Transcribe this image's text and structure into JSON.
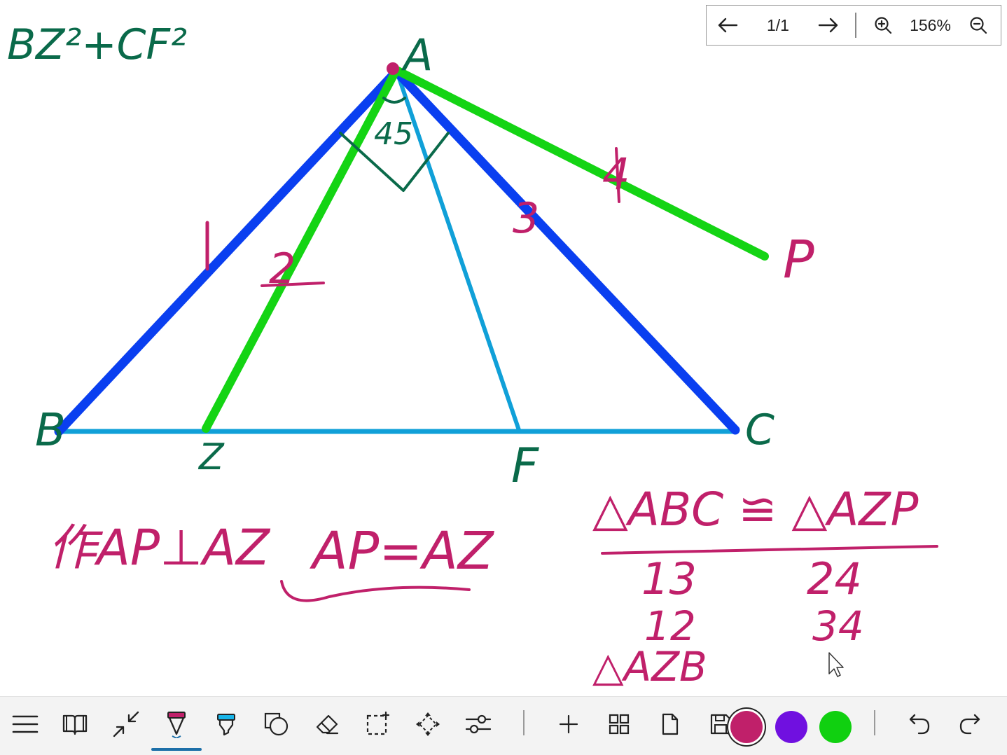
{
  "nav": {
    "page_indicator": "1/1",
    "zoom_level": "156%"
  },
  "canvas": {
    "corner_formula": "BZ²+CF²",
    "vertex_labels": [
      "A",
      "B",
      "C",
      "Z",
      "F",
      "P"
    ],
    "angle_label": "45",
    "segment_numbers": [
      "1",
      "2",
      "3",
      "4"
    ],
    "note_construct": "作AP⊥AZ",
    "note_equal": "AP=AZ",
    "note_congruence": "△ABC ≌ △AZP",
    "note_row1_left": "13",
    "note_row1_right": "24",
    "note_row2_left": "12",
    "note_row2_right": "34",
    "note_row3_left": "△AZB"
  },
  "toolbar": {
    "tools": [
      "menu-icon",
      "book-icon",
      "collapse-icon",
      "pen-icon",
      "highlighter-icon",
      "shape-icon",
      "eraser-icon",
      "lasso-select-icon",
      "pan-icon",
      "settings-icon",
      "add-page-icon",
      "grid-icon",
      "page-icon",
      "save-icon",
      "undo-icon",
      "redo-icon"
    ],
    "colors": {
      "crimson": "#c0206a",
      "violet": "#7010e0",
      "green": "#10d010"
    },
    "active_tool": "pen-icon"
  },
  "ink": {
    "blue": "#0a3ff0",
    "light_blue": "#10a0d8",
    "green": "#14d414",
    "teal": "#0a6a4a",
    "crimson": "#c0206a"
  }
}
